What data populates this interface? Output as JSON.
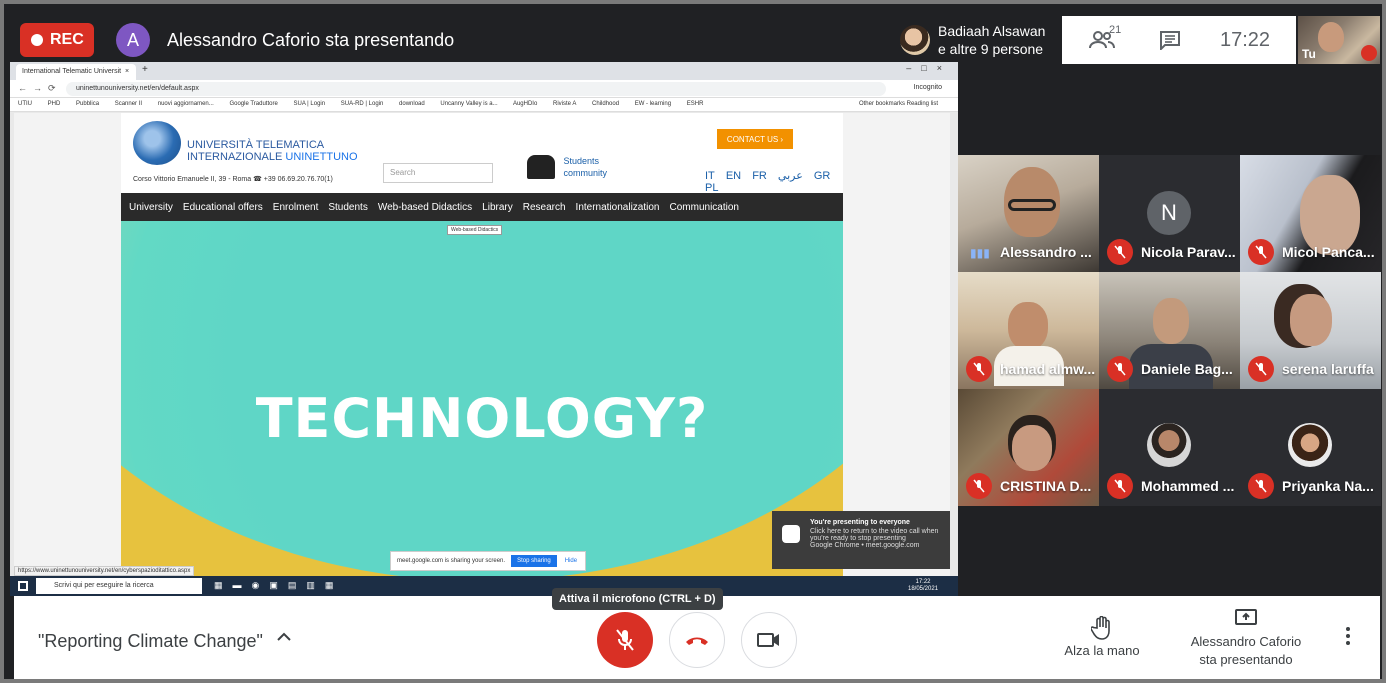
{
  "recording": {
    "label": "REC",
    "accent": "#d93025"
  },
  "presenter": {
    "avatar_letter": "A",
    "title": "Alessandro Caforio sta presentando"
  },
  "joined": {
    "line1": "Badiaah Alsawan",
    "line2": "e altre 9 persone"
  },
  "info": {
    "people_count": "21",
    "time": "17:22"
  },
  "self": {
    "label": "Tu"
  },
  "browser": {
    "tab_title": "International Telematic Universit",
    "url": "uninettunouniversity.net/en/default.aspx",
    "incognito": "Incognito",
    "bookmarks": [
      "UTIU",
      "PHD",
      "Pubblica",
      "Scanner II",
      "nuovi aggiornamen...",
      "Google Traduttore",
      "SUA | Login",
      "SUA-RD | Login",
      "download",
      "Uncanny Valley is a...",
      "AugHDIo",
      "Riviste A",
      "Childhood",
      "EW - learning",
      "ESHR"
    ],
    "bookmarks_right": "Other bookmarks   Reading list",
    "status_url": "https://www.uninettunouniversity.net/en/cyberspazioditattico.aspx"
  },
  "site": {
    "logo_line1": "UNIVERSITÀ TELEMATICA",
    "logo_line2": "INTERNAZIONALE",
    "logo_brand": "UNINETTUNO",
    "address": "Corso Vittorio Emanuele II, 39 - Roma  ☎ +39 06.69.20.76.70(1)",
    "search_placeholder": "Search",
    "students_line1": "Students",
    "students_line2": "community",
    "contact": "CONTACT US ›",
    "languages": [
      "IT",
      "EN",
      "FR",
      "عربي",
      "GR",
      "PL"
    ],
    "nav": [
      "University",
      "Educational offers",
      "Enrolment",
      "Students",
      "Web-based Didactics",
      "Library",
      "Research",
      "Internationalization",
      "Communication"
    ],
    "tooltip": "Web-based Didactics",
    "hero_text": "TECHNOLOGY?"
  },
  "sharebar": {
    "text": "meet.google.com is sharing your screen.",
    "stop": "Stop sharing",
    "hide": "Hide"
  },
  "toast": {
    "title": "You're presenting to everyone",
    "body": "Click here to return to the video call when you're ready to stop presenting",
    "source": "Google Chrome • meet.google.com"
  },
  "taskbar": {
    "search": "Scrivi qui per eseguire la ricerca",
    "time": "17:22",
    "date": "18/05/2021"
  },
  "participants": [
    {
      "name": "Alessandro ...",
      "muted": false,
      "style": "video"
    },
    {
      "name": "Nicola Parav...",
      "muted": true,
      "style": "letter",
      "letter": "N"
    },
    {
      "name": "Micol Panca...",
      "muted": true,
      "style": "video"
    },
    {
      "name": "hamad almw...",
      "muted": true,
      "style": "video"
    },
    {
      "name": "Daniele Bag...",
      "muted": true,
      "style": "video"
    },
    {
      "name": "serena laruffa",
      "muted": true,
      "style": "video"
    },
    {
      "name": "CRISTINA D...",
      "muted": true,
      "style": "video"
    },
    {
      "name": "Mohammed ...",
      "muted": true,
      "style": "avatar"
    },
    {
      "name": "Priyanka Na...",
      "muted": true,
      "style": "avatar"
    }
  ],
  "bottom": {
    "meeting_title": "\"Reporting Climate Change\"",
    "mic_tooltip": "Attiva il microfono (CTRL + D)",
    "raise_hand": "Alza la mano",
    "presenting_line1": "Alessandro Caforio",
    "presenting_line2": "sta presentando"
  }
}
